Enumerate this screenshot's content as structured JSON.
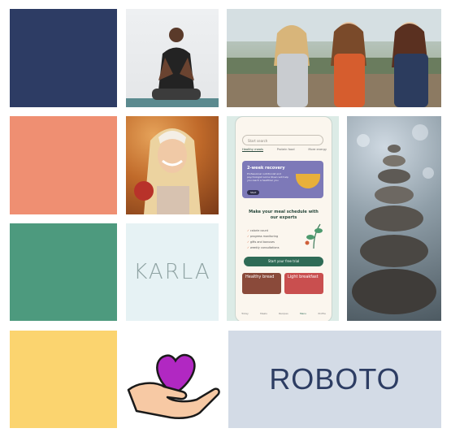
{
  "palette": {
    "navy": "#2d3c64",
    "salmon": "#ef8f72",
    "green": "#4d9a7e",
    "yellow": "#fbd46f"
  },
  "photos": {
    "yoga": "woman-meditating-photo",
    "friends": "three-friends-laughing-photo",
    "smiling_woman": "smiling-woman-autumn-photo",
    "stones": "stacked-stones-photo"
  },
  "phone": {
    "search_placeholder": "Start search",
    "tabs": [
      "Healthy meals",
      "Protein food",
      "More energy"
    ],
    "card": {
      "title": "2-week recovery",
      "desc": "Professional nutritionist and psychologist Lorna Olsen will help you reach a healthier you",
      "button": "Start"
    },
    "heading": "Make your meal schedule with our experts",
    "list": [
      "calorie count",
      "progress monitoring",
      "gifts and bonuses",
      "weekly consultations"
    ],
    "cta": "Start your free trial",
    "mini1": "Healthy bread",
    "mini2": "Light breakfast",
    "nav": [
      "Today",
      "Meals",
      "Recipes",
      "Menu",
      "Profile"
    ]
  },
  "font_samples": {
    "karla": "KARLA",
    "roboto": "ROBOTO"
  },
  "logo": {
    "icon": "hand-holding-heart-icon"
  }
}
